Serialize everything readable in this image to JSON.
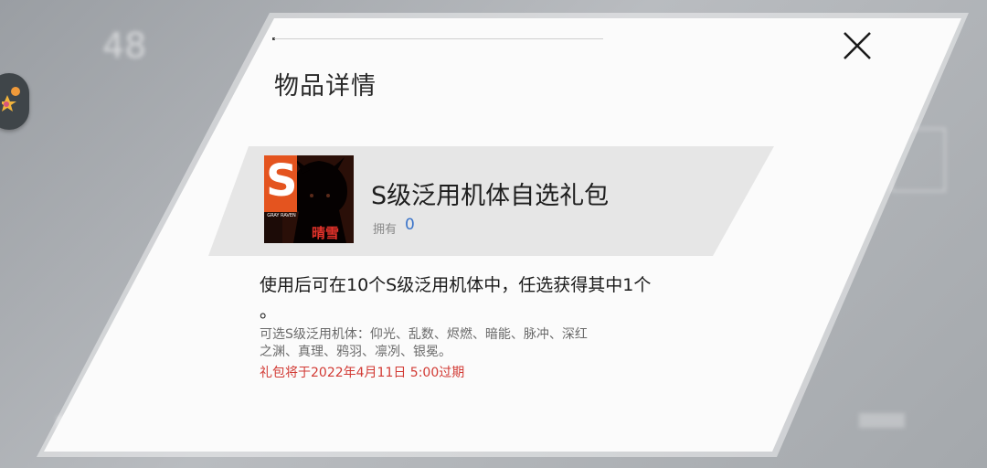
{
  "background": {
    "number": "48"
  },
  "dialog": {
    "title": "物品详情",
    "close_icon": "close-icon"
  },
  "item": {
    "icon": {
      "letter": "S",
      "brand": "GRAY RAVEN",
      "mark": "晴雪"
    },
    "name": "S级泛用机体自选礼包",
    "owned_label": "拥有",
    "owned_count": "0",
    "description_line1": "使用后可在10个S级泛用机体中，任选获得其中1个",
    "description_line2": "。",
    "options_line1": "可选S级泛用机体：仰光、乱数、烬燃、暗能、脉冲、深红",
    "options_line2": "之渊、真理、鸦羽、凛冽、银冕。",
    "expiry": "礼包将于2022年4月11日 5:00过期"
  },
  "colors": {
    "accent_blue": "#3b74c9",
    "expiry_red": "#d23a34",
    "icon_orange": "#e4541f"
  }
}
